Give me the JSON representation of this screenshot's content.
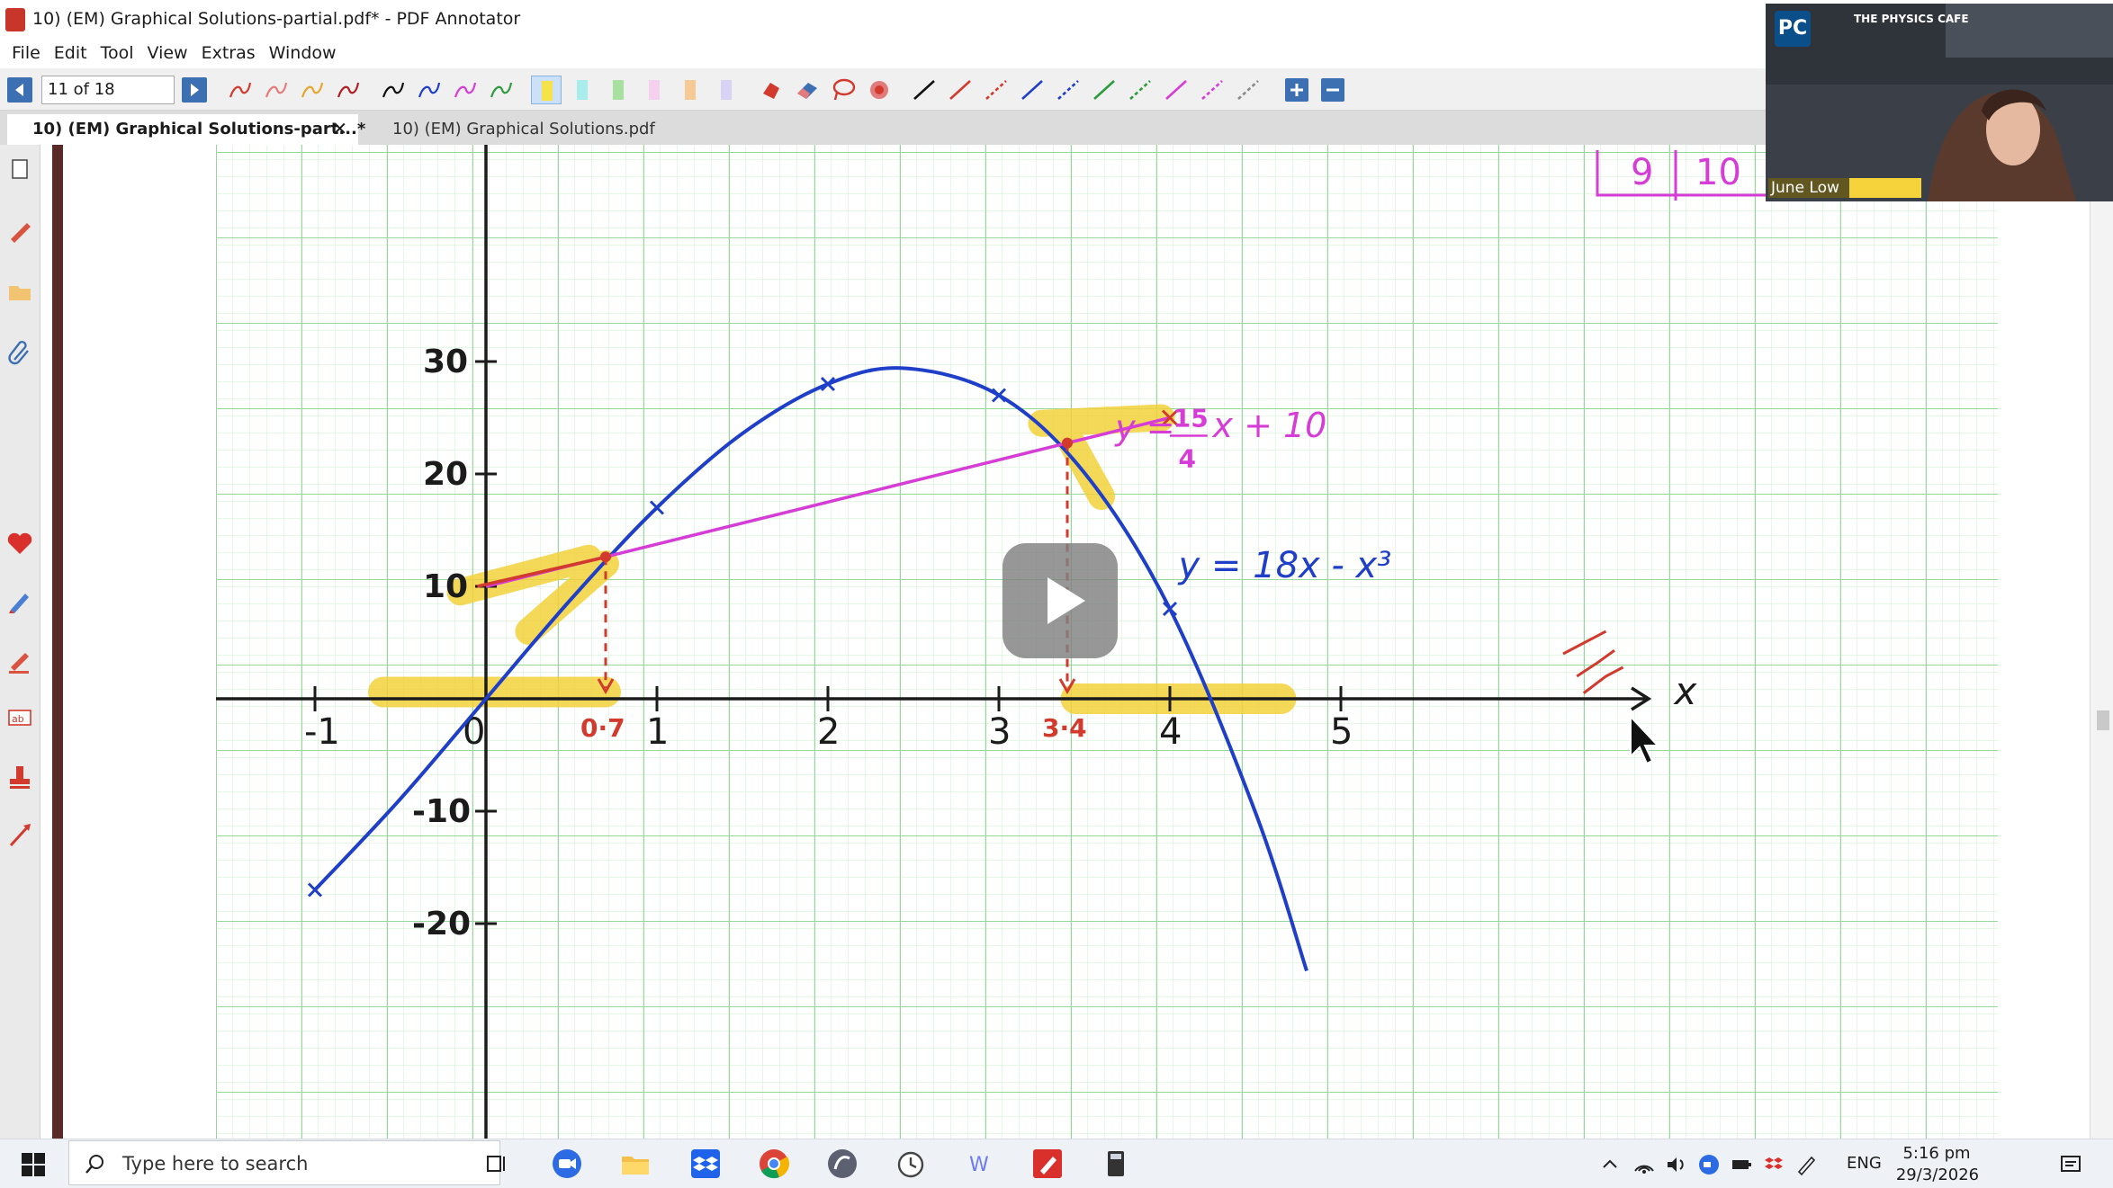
{
  "window": {
    "title": "10) (EM) Graphical Solutions-partial.pdf* - PDF Annotator"
  },
  "menu": [
    "File",
    "Edit",
    "Tool",
    "View",
    "Extras",
    "Window"
  ],
  "toolbar": {
    "page_indicator": "11 of 18",
    "colors": {
      "red": "#d23a2e",
      "yellow": "#f2d13b",
      "blue": "#1f3fc9",
      "magenta": "#d63cd6",
      "green": "#2e9b3c",
      "black": "#111111"
    }
  },
  "tabs": [
    {
      "label": "10) (EM) Graphical Solutions-part...*",
      "close": "✕"
    },
    {
      "label": "10) (EM) Graphical Solutions.pdf"
    }
  ],
  "webcam": {
    "logo": "PC",
    "brand": "THE PHYSICS CAFE",
    "presenter": "June Low",
    "corner_numbers": [
      "9",
      "10"
    ]
  },
  "chart_data": {
    "type": "line",
    "title": "",
    "xlabel": "x",
    "ylabel": "",
    "xlim": [
      -1.0,
      5.0
    ],
    "ylim": [
      -20,
      30
    ],
    "x_ticks": [
      "-1",
      "0",
      "1",
      "2",
      "3",
      "4",
      "5"
    ],
    "y_ticks": [
      "30",
      "20",
      "10",
      "-10",
      "-20"
    ],
    "series": [
      {
        "name": "y = 18x - x³",
        "x": [
          -1,
          -0.5,
          0,
          0.5,
          1,
          1.5,
          2,
          2.45,
          3,
          3.5,
          4,
          4.5,
          4.8
        ],
        "y": [
          -17,
          -8.9,
          0,
          8.9,
          17,
          23.6,
          28,
          29.4,
          27,
          20.1,
          8,
          -10.1,
          -24.2
        ]
      },
      {
        "name": "y = 15/4 x + 10",
        "x": [
          0,
          4
        ],
        "y": [
          10,
          25
        ]
      }
    ],
    "annotations": {
      "curve_label": "y = 18x - x³",
      "line_label_prefix": "y =",
      "line_label_frac_num": "15",
      "line_label_frac_den": "4",
      "line_label_suffix": "x + 10",
      "solutions": [
        "0·7",
        "3·4"
      ],
      "solution_x": [
        0.7,
        3.4
      ]
    }
  },
  "taskbar": {
    "search_placeholder": "Type here to search",
    "language": "ENG",
    "time": "5:16 pm",
    "date": "29/3/2026",
    "apps": [
      "task-view",
      "zoom",
      "file-explorer",
      "dropbox",
      "chrome",
      "app-swirl",
      "alarms",
      "word-app",
      "pdf-annotator",
      "calculator"
    ]
  }
}
